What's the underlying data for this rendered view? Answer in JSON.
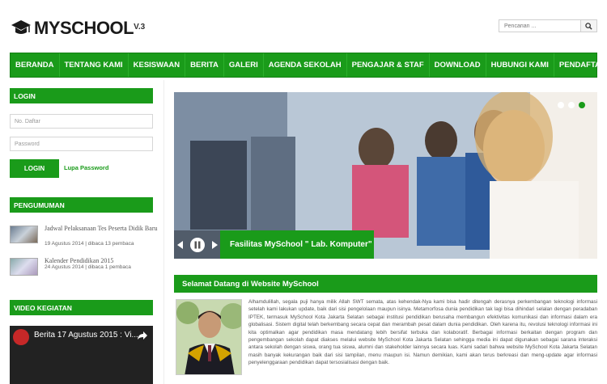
{
  "header": {
    "logo_text": "MYSCHOOL",
    "logo_version": "V.3",
    "search_placeholder": "Pencarian ..."
  },
  "nav": {
    "items": [
      "BERANDA",
      "TENTANG KAMI",
      "KESISWAAN",
      "BERITA",
      "GALERI",
      "AGENDA SEKOLAH",
      "PENGAJAR & STAF",
      "DOWNLOAD",
      "HUBUNGI KAMI",
      "PENDAFTARAN"
    ]
  },
  "login": {
    "heading": "LOGIN",
    "username_placeholder": "No. Daftar",
    "password_placeholder": "Password",
    "button": "LOGIN",
    "forgot": "Lupa Password"
  },
  "announcements": {
    "heading": "PENGUMUMAN",
    "items": [
      {
        "title": "Jadwal Pelaksanaan Tes Peserta Didik Baru",
        "meta": "19 Agustus 2014 | dibaca 13 pembaca"
      },
      {
        "title": "Kalender Pendidikan 2015",
        "meta": "24 Agustus 2014 | dibaca 1 pembaca"
      }
    ]
  },
  "video": {
    "heading": "VIDEO KEGIATAN",
    "title": "Berita 17 Agustus 2015 : Vi..."
  },
  "slider": {
    "caption": "Fasilitas MySchool \" Lab. Komputer\""
  },
  "welcome": {
    "heading": "Selamat Datang di Website MySchool",
    "body": "Alhamdulillah, segala puji hanya milik Allah SWT semata, atas kehendak-Nya kami bisa hadir ditengah derasnya perkembangan teknologi informasi setelah kami lakukan update, baik dari sisi pengelolaan maupun isinya. Metamorfosa dunia pendidikan tak lagi bisa dihindari selalan dengan peradaban IPTEK, termasuk MySchool Kota Jakarta Selatan sebagai institusi pendidikan berusaha membangun efektivitas komunikasi dan informasi dalam era globalisasi. Sistem digital telah berkembang secara cepat dan merambah pesat dalam dunia pendidikan. Oleh karena itu, revolusi teknologi informasi ini kita optimalkan agar pendidikan masa mendatang lebih bersifat terbuka dan kolaboratif. Berbagai informasi berkaitan dengan program dan pengembangan sekolah dapat diakses melalui website MySchool Kota Jakarta Selatan sehingga media ini dapat digunakan sebagai sarana interaksi antara sekolah dengan siswa, orang tua siswa, alumni dan stakeholder lainnya secara luas. Kami sadari bahwa website MySchool Kota Jakarta Selatan masih banyak kekurangan baik dari sisi tampilan, menu maupun isi. Namun demikian, kami akan terus berkreasi dan meng-update agar informasi penyelenggaraan pendidikan dapat tersosialisasi dengan baik."
  },
  "colors": {
    "accent": "#1a9b1a"
  }
}
